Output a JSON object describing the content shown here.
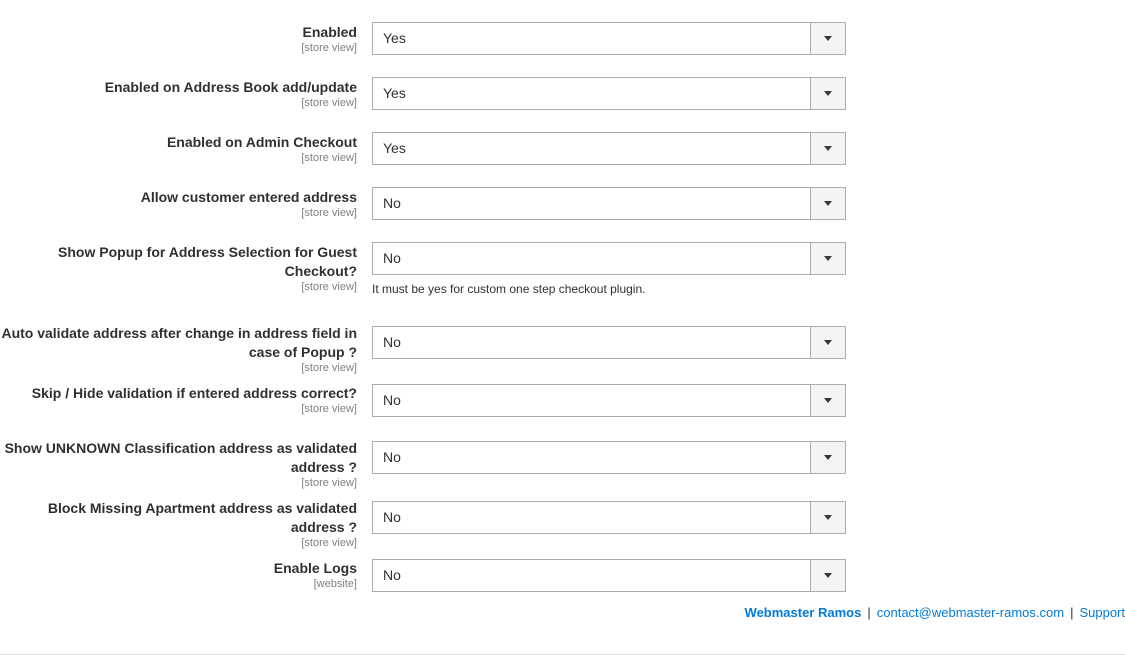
{
  "fields": [
    {
      "label": "Enabled",
      "scope": "[store view]",
      "value": "Yes"
    },
    {
      "label": "Enabled on Address Book add/update",
      "scope": "[store view]",
      "value": "Yes"
    },
    {
      "label": "Enabled on Admin Checkout",
      "scope": "[store view]",
      "value": "Yes"
    },
    {
      "label": "Allow customer entered address",
      "scope": "[store view]",
      "value": "No"
    },
    {
      "label": "Show Popup for Address Selection for Guest Checkout?",
      "scope": "[store view]",
      "value": "No",
      "note": "It must be yes for custom one step checkout plugin."
    },
    {
      "label": "Auto validate address after change in address field in case of Popup ?",
      "scope": "[store view]",
      "value": "No"
    },
    {
      "label": "Skip / Hide validation if entered address correct?",
      "scope": "[store view]",
      "value": "No"
    },
    {
      "label": "Show UNKNOWN Classification address as validated address ?",
      "scope": "[store view]",
      "value": "No"
    },
    {
      "label": "Block Missing Apartment address as validated address ?",
      "scope": "[store view]",
      "value": "No"
    },
    {
      "label": "Enable Logs",
      "scope": "[website]",
      "value": "No"
    }
  ],
  "footer": {
    "brand": "Webmaster Ramos",
    "separator": "|",
    "email": "contact@webmaster-ramos.com",
    "support": "Support"
  },
  "icons": {
    "dropdown": "chevron-down-icon"
  },
  "colors": {
    "link": "#007bdb",
    "text": "#303030",
    "scope": "#808080",
    "border": "#adadad",
    "arrow_bg": "#f4f4f4"
  }
}
